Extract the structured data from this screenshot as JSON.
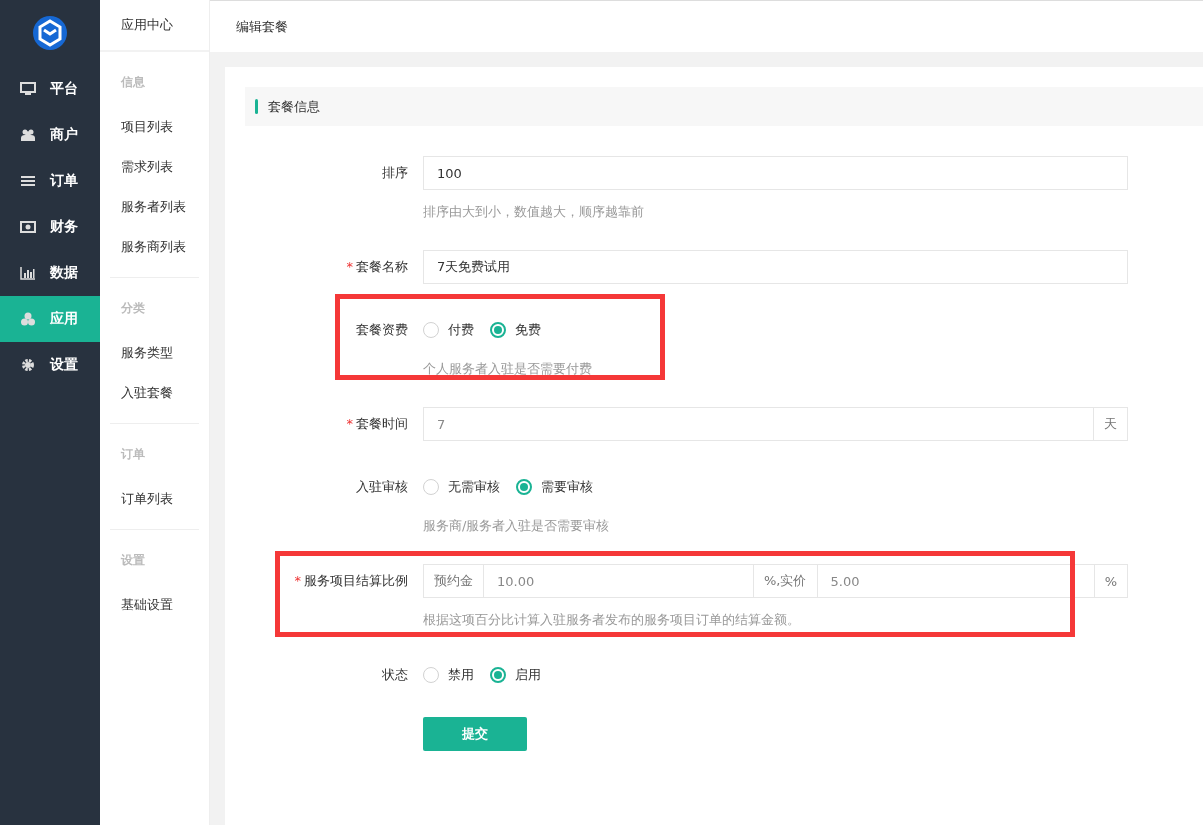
{
  "sidebar": {
    "items": [
      {
        "label": "平台",
        "selected": false
      },
      {
        "label": "商户",
        "selected": false
      },
      {
        "label": "订单",
        "selected": false
      },
      {
        "label": "财务",
        "selected": false
      },
      {
        "label": "数据",
        "selected": false
      },
      {
        "label": "应用",
        "selected": true
      },
      {
        "label": "设置",
        "selected": false
      }
    ]
  },
  "subnav": {
    "title": "应用中心",
    "groups": [
      {
        "heading": "信息",
        "items": [
          "项目列表",
          "需求列表",
          "服务者列表",
          "服务商列表"
        ]
      },
      {
        "heading": "分类",
        "items": [
          "服务类型",
          "入驻套餐"
        ]
      },
      {
        "heading": "订单",
        "items": [
          "订单列表"
        ]
      },
      {
        "heading": "设置",
        "items": [
          "基础设置"
        ]
      }
    ]
  },
  "header": {
    "title": "编辑套餐"
  },
  "section": {
    "title": "套餐信息"
  },
  "fields": [
    {
      "kind": "text",
      "label": "排序",
      "disabled": false,
      "highlighted": false,
      "value": "100",
      "help": "排序由大到小，数值越大，顺序越靠前"
    },
    {
      "kind": "text",
      "label": "套餐名称",
      "required_mark": "*",
      "disabled": false,
      "highlighted": false,
      "value": "7天免费试用"
    },
    {
      "kind": "radio",
      "label": "套餐资费",
      "highlighted": true,
      "options": [
        {
          "label": "付费",
          "selected": false
        },
        {
          "label": "免费",
          "selected": true
        }
      ],
      "help": "个人服务者入驻是否需要付费"
    },
    {
      "kind": "addon",
      "label": "套餐时间",
      "required_mark": "*",
      "disabled": true,
      "highlighted": false,
      "value": "7",
      "suffix": "天"
    },
    {
      "kind": "radio",
      "label": "入驻审核",
      "highlighted": false,
      "options": [
        {
          "label": "无需审核",
          "selected": false
        },
        {
          "label": "需要审核",
          "selected": true
        }
      ],
      "help": "服务商/服务者入驻是否需要审核"
    },
    {
      "kind": "ratio",
      "label": "服务项目结算比例",
      "required_mark": "*",
      "disabled": true,
      "highlighted": true,
      "prefix": "预约金",
      "value": "10.00",
      "middle": "%,实价",
      "value2": "5.00",
      "suffix": "%",
      "help": "根据这项百分比计算入驻服务者发布的服务项目订单的结算金额。"
    },
    {
      "kind": "radio",
      "label": "状态",
      "highlighted": false,
      "options": [
        {
          "label": "禁用",
          "selected": false
        },
        {
          "label": "启用",
          "selected": true
        }
      ]
    }
  ],
  "submit": "提交"
}
